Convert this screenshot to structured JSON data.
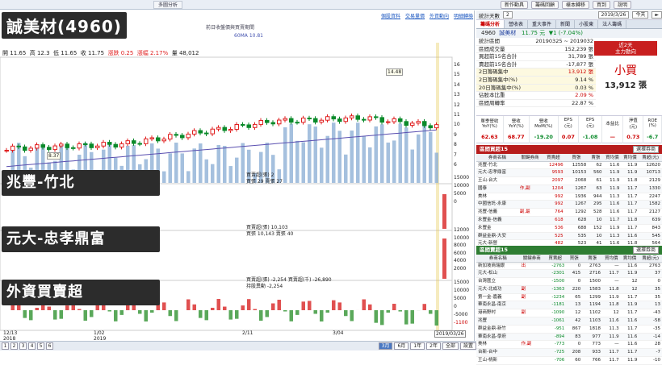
{
  "topbar": {
    "tabs": [
      "",
      "",
      "",
      "",
      "",
      "",
      "",
      "",
      "",
      "",
      "",
      "多圖分析"
    ],
    "right_buttons": [
      "新作動具",
      "籌碼回顧",
      "樣本轉移",
      "買到",
      "說明"
    ]
  },
  "overlays": {
    "stock_title": "誠美材(4960)",
    "branch1": "兆豐-竹北",
    "branch2": "元大-忠孝鼎富",
    "branch3": "外資買賣超"
  },
  "chart": {
    "title_line": "前日收盤價與買賣期間",
    "ma_label": "60MA 10.81",
    "ohlc": {
      "open_label": "開",
      "open": "11.65",
      "high_label": "高",
      "high": "12.3",
      "low_label": "低",
      "low": "11.65",
      "close_label": "收",
      "close": "11.75",
      "chg_label": "漲跌",
      "chg": "0.25",
      "pct_label": "漲幅",
      "pct": "2.17%",
      "vol_label": "量",
      "vol": "48,012"
    },
    "peak_label": "14.48",
    "low_label": "8.37",
    "yaxis": [
      "16",
      "15",
      "14",
      "13",
      "12",
      "11",
      "10",
      "9",
      "8",
      "7",
      "6"
    ],
    "xaxis": [
      "12/13\n2018",
      "1/02\n2019",
      "2/11",
      "3/04",
      "2019/03/26"
    ],
    "sub1": {
      "label": "買賣超(張) 2",
      "sub": "買張 29 賣張 27",
      "yaxis": [
        "15000",
        "10000",
        "5000",
        "0"
      ]
    },
    "sub2": {
      "label": "買賣超(張) 10,103",
      "sub": "買張 10,143 賣張 40",
      "yaxis": [
        "12000",
        "10000",
        "8000",
        "6000",
        "4000",
        "2000"
      ]
    },
    "sub3": {
      "label": "買賣超(張) -2,254 買賣超(千) -26,890",
      "sub": "持股異動 -2,254",
      "yaxis": [
        "15000",
        "10000",
        "5000",
        "0",
        "-5000",
        "-1100"
      ]
    },
    "links": [
      "個股資料",
      "交易量價",
      "外資動向",
      "明細轉換"
    ]
  },
  "right": {
    "count_label": "統計天數",
    "count": "2",
    "date": "2019/3/26",
    "btns": [
      "今天",
      "►"
    ],
    "tabs": [
      "籌碼分析",
      "營收表",
      "重大事件",
      "新聞",
      "小股東",
      "法人籌碼"
    ],
    "stock": {
      "code": "4960",
      "name": "誠美材",
      "price": "11.75 元",
      "chg": "▼1 (-7.04%)"
    },
    "summary": [
      {
        "k": "統計區間",
        "v": "20190325 ~ 2019032"
      },
      {
        "k": "區間成交量",
        "v": "152,239 張"
      },
      {
        "k": "買超前15名合計",
        "v": "31,789 張"
      },
      {
        "k": "賣超前15名合計",
        "v": "-17,877 張"
      },
      {
        "k": "2日籌碼集中",
        "v": "13,912 張"
      },
      {
        "k": "2日籌碼集中(%)",
        "v": "9.14 %"
      },
      {
        "k": "20日籌碼集中(%)",
        "v": "0.03 %"
      },
      {
        "k": "佔股本比重",
        "v": "2.09 %"
      },
      {
        "k": "區間周轉率",
        "v": "22.87 %"
      }
    ],
    "badge": "近2天\n主力動向",
    "verdict": "小買",
    "verdict_amt": "13,912 張",
    "fin_head": [
      "單季營收\nYoY(%)",
      "營收\nYoY(%)",
      "營收\nMoM(%)",
      "EPS\n(元)",
      "EPS\n(元)",
      "本益比",
      "淨值\n(元)",
      "ROE\n(%)"
    ],
    "fin_vals": [
      "62.63",
      "68.77",
      "-19.20",
      "0.07",
      "-1.08",
      "—",
      "0.73",
      "-6.7"
    ],
    "buy_head": "區間買超15",
    "buy_filter": "選擇券商",
    "sell_head": "區間賣超15",
    "sell_filter": "選擇券商",
    "cols": [
      "券商名稱",
      "關鍵券商",
      "買賣超",
      "買張",
      "賣張",
      "買均價",
      "賣均價",
      "賣超(元)"
    ],
    "buy_rows": [
      [
        "兆豐-竹北",
        "",
        "12496",
        "12558",
        "62",
        "11.6",
        "11.9",
        "12620"
      ],
      [
        "元大-忠孝鼎富",
        "",
        "9593",
        "10153",
        "560",
        "11.9",
        "11.9",
        "10713"
      ],
      [
        "王山-台大",
        "",
        "2097",
        "2068",
        "61",
        "11.9",
        "11.8",
        "2129"
      ],
      [
        "國泰",
        "作,副",
        "1204",
        "1267",
        "63",
        "11.9",
        "11.7",
        "1330"
      ],
      [
        "美林",
        "",
        "992",
        "1936",
        "944",
        "11.3",
        "11.7",
        "2247"
      ],
      [
        "中國信託-永康",
        "",
        "992",
        "1267",
        "295",
        "11.6",
        "11.7",
        "1582"
      ],
      [
        "兆豐-信義",
        "副,最",
        "764",
        "1292",
        "528",
        "11.6",
        "11.7",
        "2127"
      ],
      [
        "永豐金-信義",
        "",
        "618",
        "628",
        "10",
        "11.7",
        "11.8",
        "639"
      ],
      [
        "永豐金",
        "",
        "536",
        "688",
        "152",
        "11.9",
        "11.7",
        "843"
      ],
      [
        "群益金鼎-大安",
        "",
        "525",
        "535",
        "10",
        "11.3",
        "11.6",
        "545"
      ],
      [
        "元大-新營",
        "",
        "482",
        "523",
        "41",
        "11.6",
        "11.8",
        "564"
      ],
      [
        "第一金-華江",
        "",
        "434",
        "693",
        "259",
        "11.7",
        "12",
        "952"
      ],
      [
        "第一金-中和",
        "",
        "391",
        "464",
        "73",
        "11.5",
        "11.8",
        "538"
      ]
    ],
    "sell_rows": [
      [
        "新加坡商瑞銀",
        "出",
        "-2763",
        "0",
        "2763",
        "—",
        "11.6",
        "2763"
      ],
      [
        "元大-松山",
        "",
        "-2301",
        "415",
        "2716",
        "11.7",
        "11.9",
        "37"
      ],
      [
        "台灣匯立",
        "",
        "-1500",
        "0",
        "1500",
        "—",
        "12",
        "0"
      ],
      [
        "元大-北成功",
        "副",
        "-1363",
        "220",
        "1583",
        "11.8",
        "12",
        "35"
      ],
      [
        "第一金-嘉義",
        "副",
        "-1234",
        "65",
        "1299",
        "11.9",
        "11.7",
        "35"
      ],
      [
        "華南永昌-南京",
        "",
        "-1181",
        "13",
        "1194",
        "11.8",
        "11.9",
        "13"
      ],
      [
        "港商野村",
        "副",
        "-1090",
        "12",
        "1102",
        "12",
        "11.7",
        "-43"
      ],
      [
        "兆豐",
        "",
        "-1061",
        "42",
        "1103",
        "11.6",
        "11.6",
        "-58"
      ],
      [
        "群益金鼎-新竹",
        "",
        "-951",
        "867",
        "1818",
        "11.3",
        "11.7",
        "-35"
      ],
      [
        "華南永昌-學府",
        "",
        "-894",
        "83",
        "977",
        "11.9",
        "11.6",
        "-14"
      ],
      [
        "美林",
        "作,副",
        "-773",
        "0",
        "773",
        "—",
        "11.6",
        "28"
      ],
      [
        "台新-台中",
        "",
        "-725",
        "208",
        "933",
        "11.7",
        "11.7",
        "-7"
      ],
      [
        "王山-桃新",
        "",
        "-706",
        "60",
        "766",
        "11.7",
        "11.9",
        "-10"
      ]
    ]
  },
  "bottom": {
    "pages": [
      "1",
      "2",
      "3",
      "4",
      "5",
      "6"
    ],
    "ranges": [
      "1年",
      "2年",
      "全部",
      "設置"
    ],
    "zoom": [
      "3月",
      "6月"
    ]
  }
}
